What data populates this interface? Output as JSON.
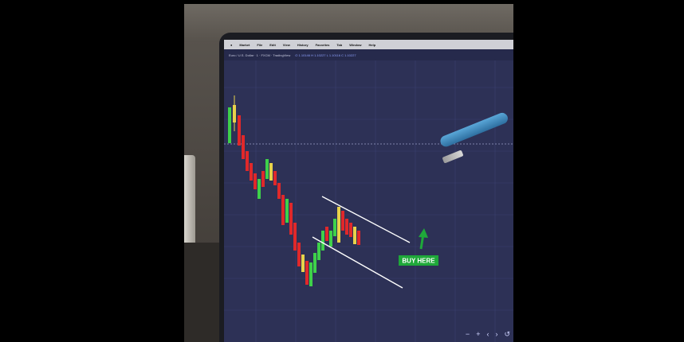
{
  "menubar": {
    "items": [
      "Market",
      "File",
      "Edit",
      "View",
      "History",
      "Favorites",
      "Tab",
      "Window",
      "Help"
    ]
  },
  "toolbar": {
    "symbol": "Euro / U.S. Dollar · 1 · FXCM · TradingView",
    "ohlc": "O 1.10146 H 1.10227 L 1.10116 C 1.10227"
  },
  "annotation": {
    "buy_label": "BUY HERE",
    "buy_color": "#1fa83a"
  },
  "colors": {
    "up_candle": "#3ed14a",
    "down_candle": "#e0282a",
    "neutral_candle": "#e8d24a",
    "screen_bg": "#2d3156"
  },
  "nav_icons": [
    "zoom-out-icon",
    "zoom-in-icon",
    "arrow-left-icon",
    "arrow-right-icon",
    "reset-icon"
  ]
}
